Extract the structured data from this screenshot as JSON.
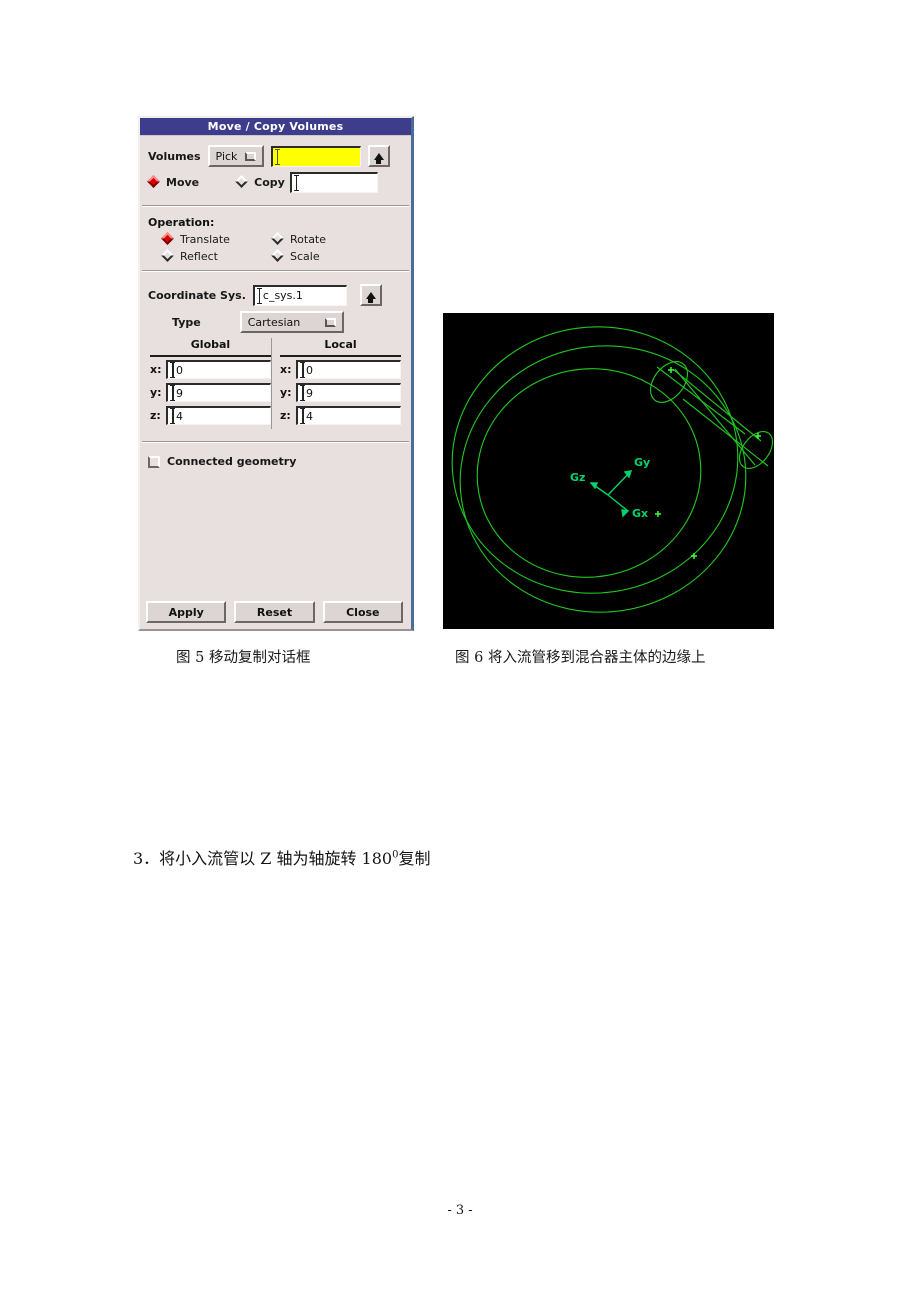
{
  "document": {
    "page_number": "- 3 -",
    "body_text_prefix": "3．将小入流管以 Z 轴为轴旋转 180",
    "body_text_sup": "0",
    "body_text_suffix": "复制",
    "caption_fig5": "图 5 移动复制对话框",
    "caption_fig6": "图 6 将入流管移到混合器主体的边缘上"
  },
  "dialog": {
    "title": "Move / Copy Volumes",
    "colors": {
      "titlebar": "#3d3d8c",
      "face": "#e8dfdf",
      "selected_radio": "#d90000",
      "highlight_field": "#ffff00",
      "right_border": "#4a6c9b"
    },
    "volumes": {
      "label": "Volumes",
      "pick_button": "Pick",
      "pick_field_value": "",
      "up_arrow": "up-arrow-icon"
    },
    "mode": {
      "move_label": "Move",
      "move_selected": true,
      "copy_label": "Copy",
      "copy_selected": false,
      "copy_count_value": ""
    },
    "operation": {
      "title": "Operation:",
      "items": [
        {
          "label": "Translate",
          "selected": true
        },
        {
          "label": "Rotate",
          "selected": false
        },
        {
          "label": "Reflect",
          "selected": false
        },
        {
          "label": "Scale",
          "selected": false
        }
      ]
    },
    "coordinate": {
      "sys_label": "Coordinate Sys.",
      "sys_value": "c_sys.1",
      "type_label": "Type",
      "type_value": "Cartesian"
    },
    "coords": {
      "global_header": "Global",
      "local_header": "Local",
      "global": [
        {
          "axis": "x:",
          "value": "0"
        },
        {
          "axis": "y:",
          "value": "9"
        },
        {
          "axis": "z:",
          "value": "4"
        }
      ],
      "local": [
        {
          "axis": "x:",
          "value": "0"
        },
        {
          "axis": "y:",
          "value": "9"
        },
        {
          "axis": "z:",
          "value": "4"
        }
      ]
    },
    "connected_geometry": {
      "label": "Connected geometry",
      "checked": false
    },
    "buttons": {
      "apply": "Apply",
      "reset": "Reset",
      "close": "Close"
    }
  },
  "viewport": {
    "background": "#000000",
    "wire_color": "#22c422",
    "axis_color": "#00d46a",
    "axis_labels": {
      "x": "Gx",
      "y": "Gy",
      "z": "Gz"
    }
  }
}
